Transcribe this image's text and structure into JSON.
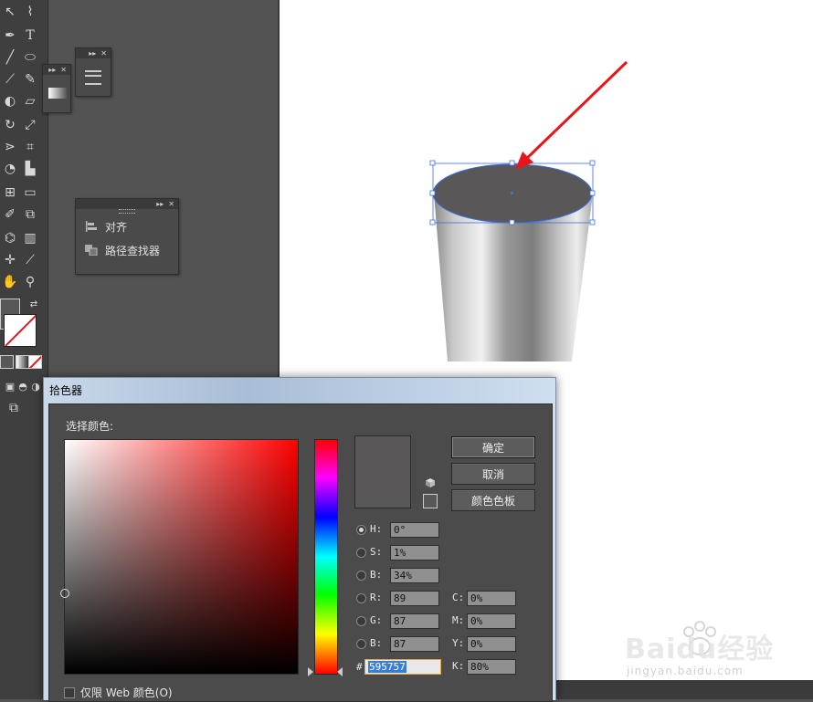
{
  "tools_panel": {
    "text_tool_glyph": "T"
  },
  "align_panel": {
    "items": [
      {
        "label": "对齐",
        "icon": "align-icon"
      },
      {
        "label": "路径查找器",
        "icon": "pathfinder-icon"
      }
    ]
  },
  "picker": {
    "title": "拾色器",
    "select_label": "选择颜色:",
    "buttons": {
      "ok": "确定",
      "cancel": "取消",
      "swatches": "颜色色板"
    },
    "hsb": [
      {
        "label": "H:",
        "value": "0°",
        "selected": true
      },
      {
        "label": "S:",
        "value": "1%",
        "selected": false
      },
      {
        "label": "B:",
        "value": "34%",
        "selected": false
      }
    ],
    "rgb": [
      {
        "label": "R:",
        "value": "89"
      },
      {
        "label": "G:",
        "value": "87"
      },
      {
        "label": "B:",
        "value": "87"
      }
    ],
    "cmyk": [
      {
        "label": "C:",
        "value": "0%"
      },
      {
        "label": "M:",
        "value": "0%"
      },
      {
        "label": "Y:",
        "value": "0%"
      },
      {
        "label": "K:",
        "value": "80%"
      }
    ],
    "hex_label": "#",
    "hex_value": "595757",
    "websafe_label": "仅限 Web 颜色(O)",
    "current_color": "#595757"
  },
  "watermark": {
    "brand": "Baidu经验",
    "url": "jingyan.baidu.com"
  },
  "colors": {
    "arrow": "#e8161b",
    "selection": "#3a6fe0",
    "cup_top": "#595757"
  }
}
